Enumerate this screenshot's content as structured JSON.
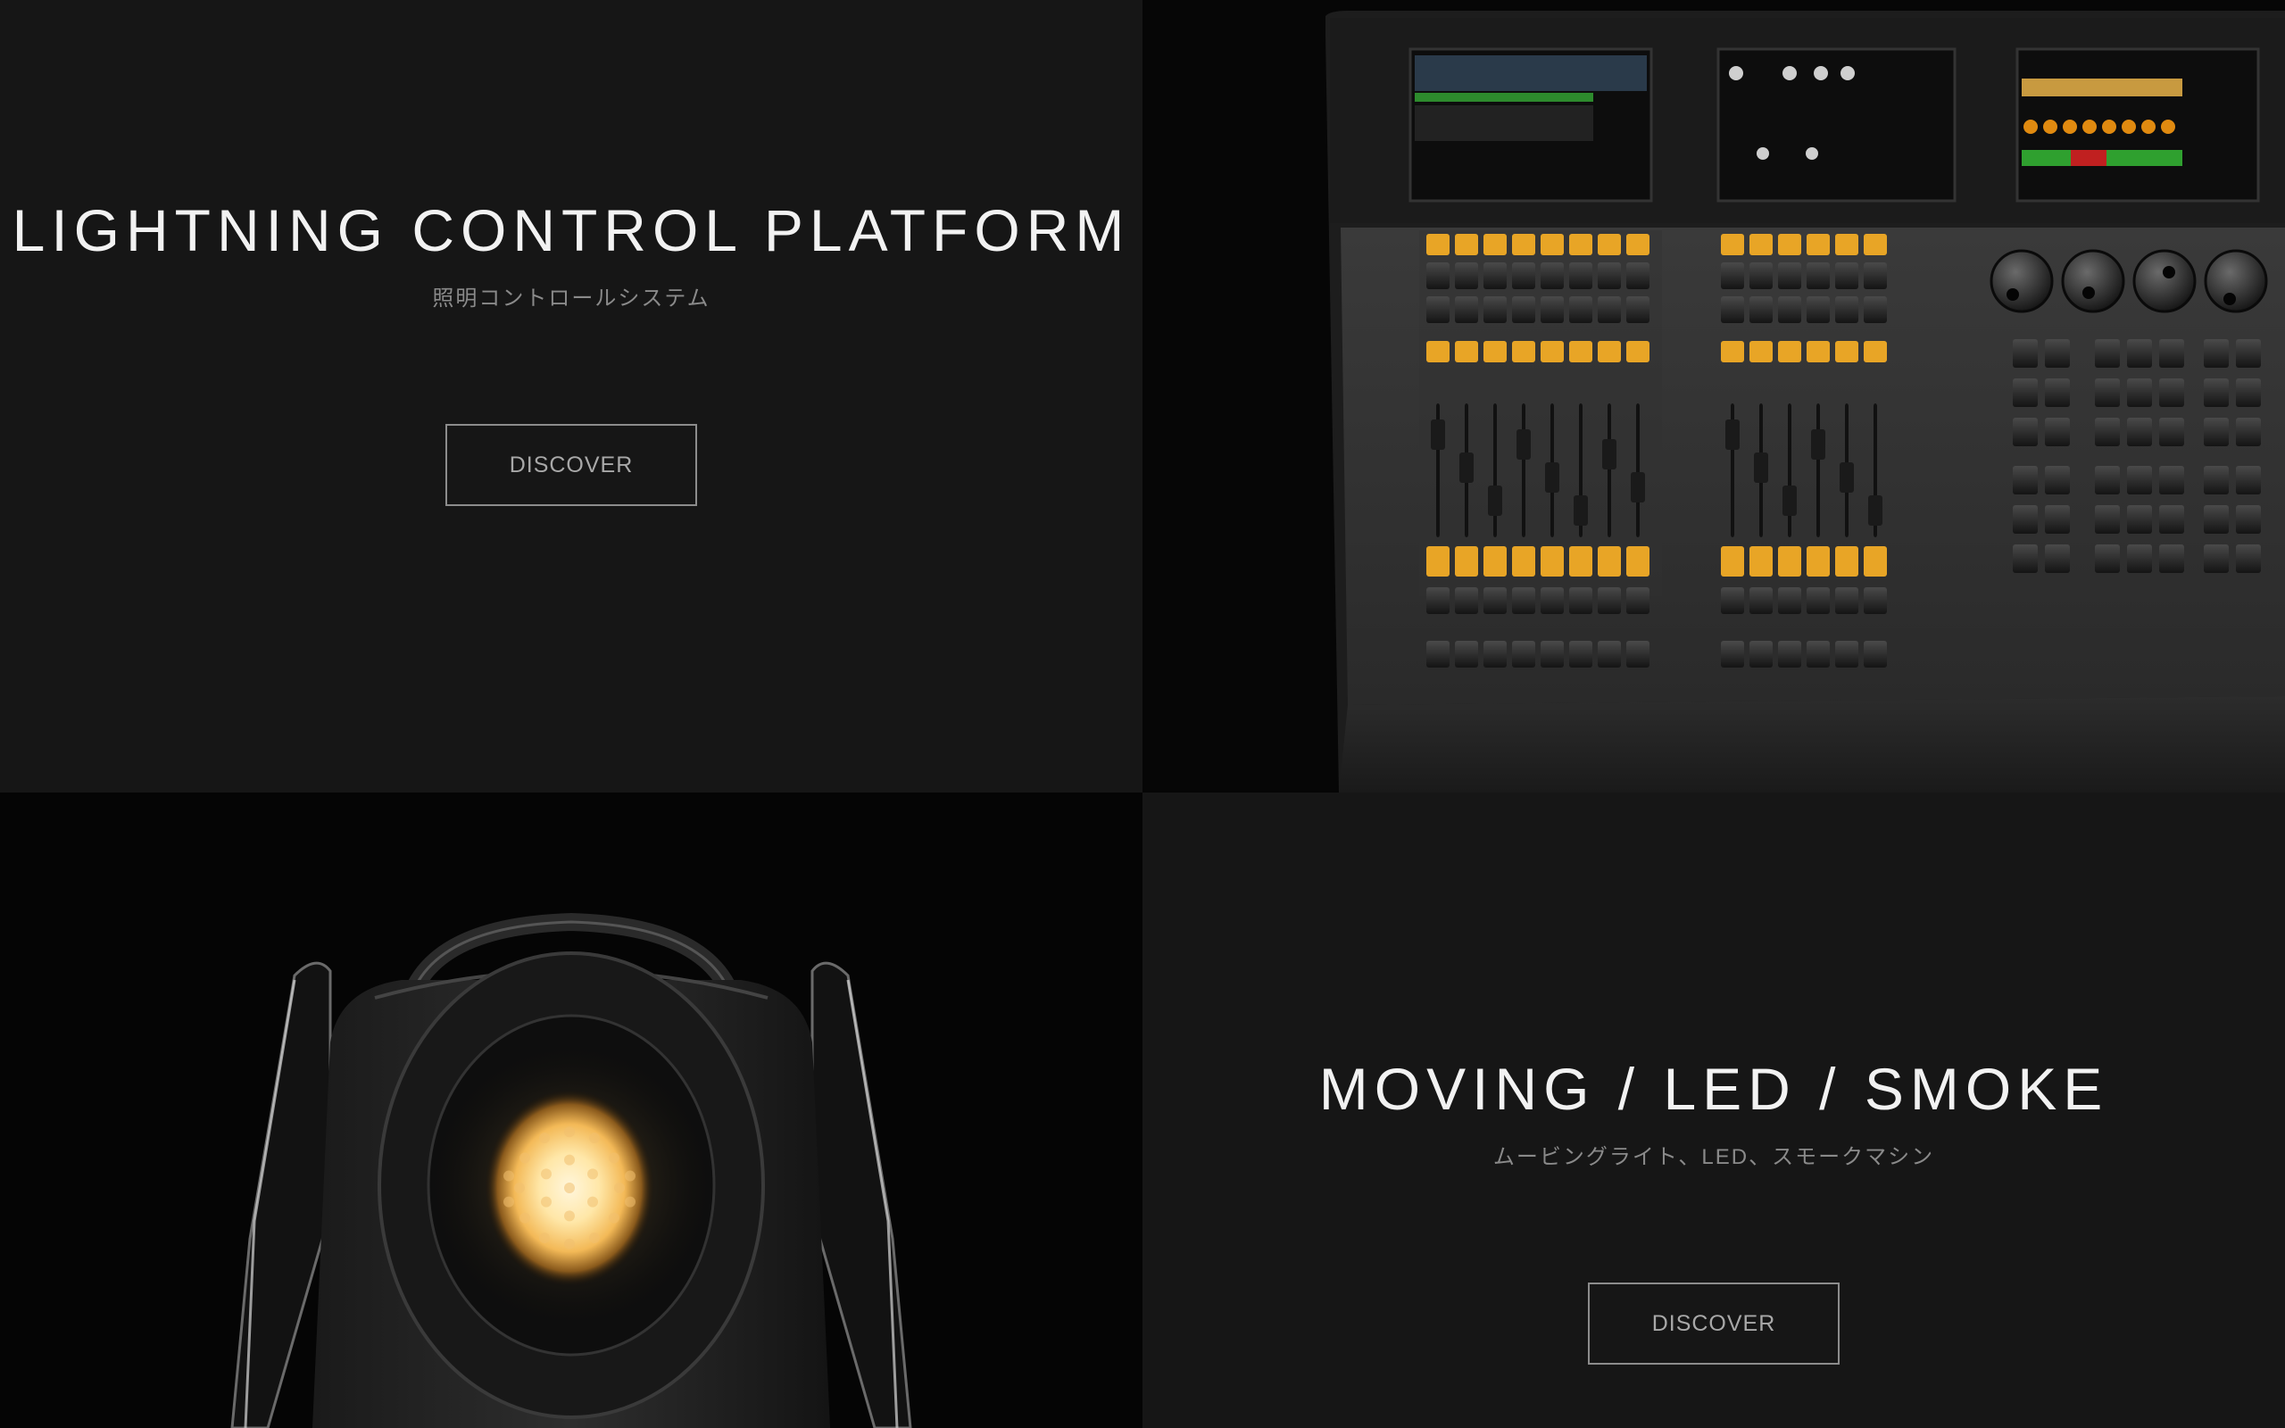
{
  "hero": {
    "title": "LIGHTNING CONTROL PLATFORM",
    "subtitle": "照明コントロールシステム",
    "button_label": "DISCOVER"
  },
  "products": {
    "title": "MOVING / LED / SMOKE",
    "subtitle": "ムービングライト、LED、スモークマシン",
    "button_label": "DISCOVER"
  },
  "images": {
    "console": "lighting-console-photo",
    "fixture": "moving-head-fixture-photo"
  },
  "colors": {
    "background": "#161616",
    "title": "#f2f2f2",
    "subtitle": "#8a8a8a",
    "button_border": "#8c8c8c",
    "console_accent": "#e8a526",
    "fixture_glow": "#ffd68a"
  }
}
